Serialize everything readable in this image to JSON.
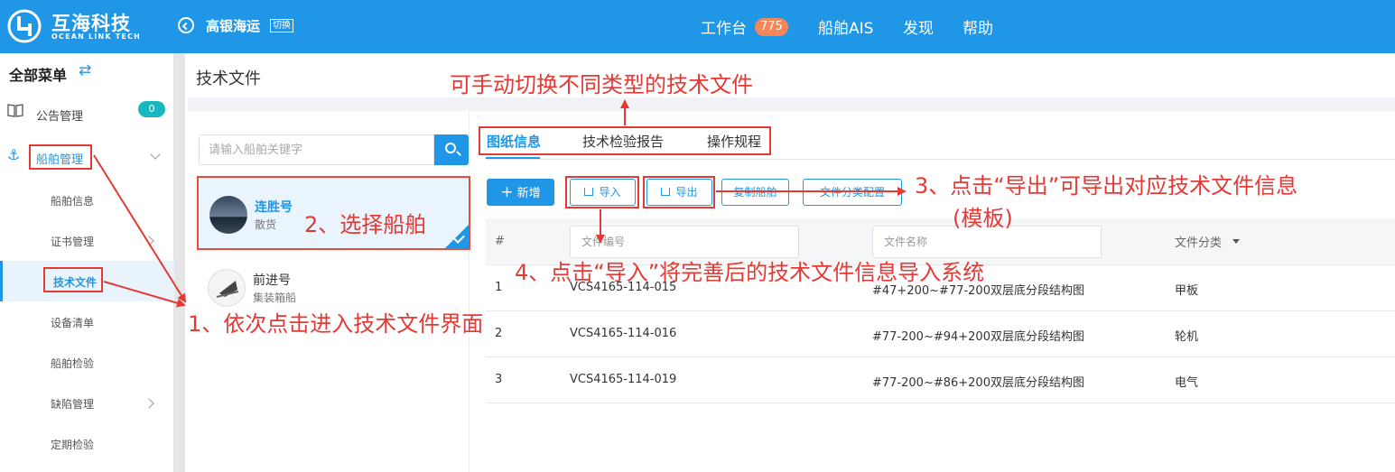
{
  "header": {
    "logo_cn": "互海科技",
    "logo_en": "OCEAN LINK TECH",
    "company": "高银海运",
    "switch_label": "切换",
    "nav": [
      {
        "label": "工作台",
        "badge": "775"
      },
      {
        "label": "船舶AIS"
      },
      {
        "label": "发现"
      },
      {
        "label": "帮助"
      }
    ]
  },
  "sidebar": {
    "title": "全部菜单",
    "toggle_icon": "⇄",
    "announce": {
      "label": "公告管理",
      "badge": "0"
    },
    "ship_mgmt": "船舶管理",
    "sub_items": [
      "船舶信息",
      "证书管理",
      "技术文件",
      "设备清单",
      "船舶检验",
      "缺陷管理",
      "定期检验"
    ]
  },
  "page": {
    "title": "技术文件",
    "search_placeholder": "请输入船舶关键字",
    "ships": [
      {
        "name": "连胜号",
        "type": "散货"
      },
      {
        "name": "前进号",
        "type": "集装箱船"
      }
    ]
  },
  "tabs": [
    "图纸信息",
    "技术检验报告",
    "操作规程"
  ],
  "buttons": {
    "add": "新增",
    "import": "导入",
    "export": "导出",
    "copy": "复制船舶",
    "config": "文件分类配置"
  },
  "table": {
    "headers": {
      "index": "#",
      "category": "文件分类"
    },
    "filter_placeholders": {
      "number": "文件编号",
      "name": "文件名称"
    },
    "rows": [
      {
        "index": "1",
        "number": "VCS4165-114-015",
        "name": "#47+200~#77-200双层底分段结构图",
        "category": "甲板"
      },
      {
        "index": "2",
        "number": "VCS4165-114-016",
        "name": "#77-200~#94+200双层底分段结构图",
        "category": "轮机"
      },
      {
        "index": "3",
        "number": "VCS4165-114-019",
        "name": "#77-200~#86+200双层底分段结构图",
        "category": "电气"
      }
    ]
  },
  "annotations": {
    "tab_hint": "可手动切换不同类型的技术文件",
    "step1": "1、依次点击进入技术文件界面",
    "step2": "2、选择船舶",
    "step3_line1": "3、点击“导出”可导出对应技术文件信息",
    "step3_line2": "(模板)",
    "step4": "4、点击“导入”将完善后的技术文件信息导入系统"
  },
  "colors": {
    "brand": "#1f96e6",
    "annotation": "#e53935",
    "badge_orange": "#f5855b",
    "badge_teal": "#19b7c0"
  }
}
